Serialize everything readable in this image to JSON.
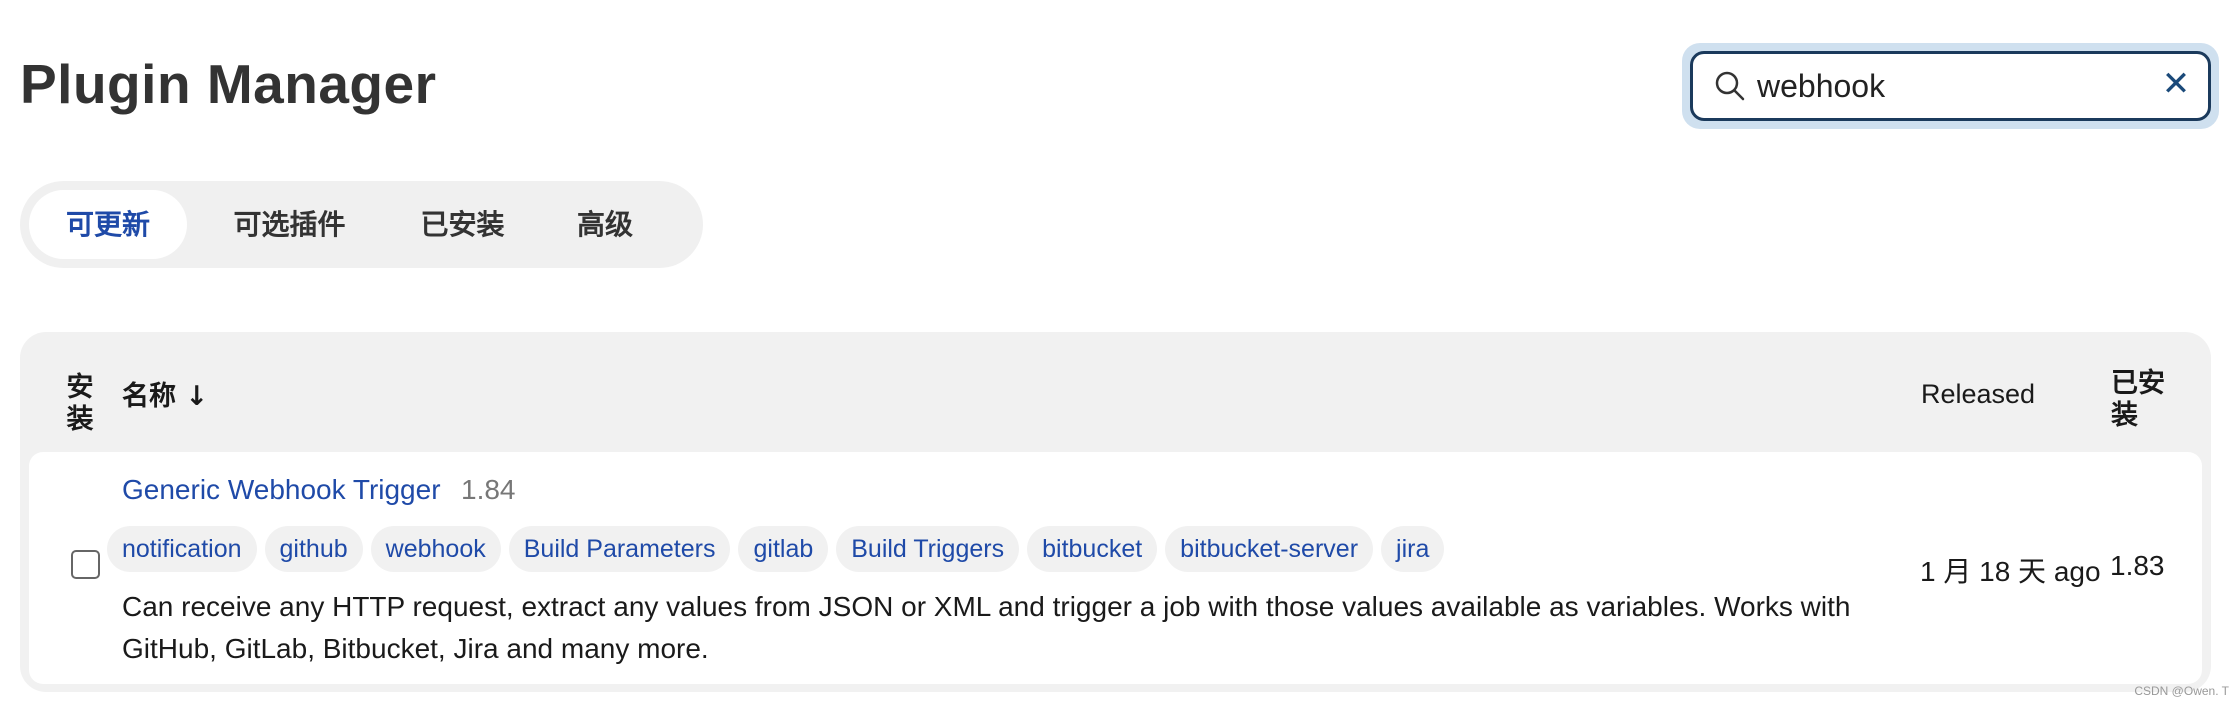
{
  "page": {
    "title": "Plugin Manager"
  },
  "search": {
    "value": "webhook",
    "placeholder": ""
  },
  "tabs": [
    {
      "label": "可更新",
      "active": true
    },
    {
      "label": "可选插件",
      "active": false
    },
    {
      "label": "已安装",
      "active": false
    },
    {
      "label": "高级",
      "active": false
    }
  ],
  "table": {
    "headers": {
      "install": "安装",
      "name": "名称 ↓",
      "released": "Released",
      "installed": "已安装"
    },
    "rows": [
      {
        "name": "Generic Webhook Trigger",
        "version": "1.84",
        "tags": [
          "notification",
          "github",
          "webhook",
          "Build Parameters",
          "gitlab",
          "Build Triggers",
          "bitbucket",
          "bitbucket-server",
          "jira"
        ],
        "description": "Can receive any HTTP request, extract any values from JSON or XML and trigger a job with those values available as variables. Works with GitHub, GitLab, Bitbucket, Jira and many more.",
        "released": "1 月 18 天 ago",
        "installed": "1.83",
        "checked": false
      }
    ]
  },
  "watermark": "CSDN @Owen. T",
  "colors": {
    "accent": "#1f4aa8",
    "search_border": "#1b3a5c",
    "search_glow": "#cfe0ef"
  },
  "icons": {
    "search": "search-icon",
    "clear": "close-icon"
  }
}
